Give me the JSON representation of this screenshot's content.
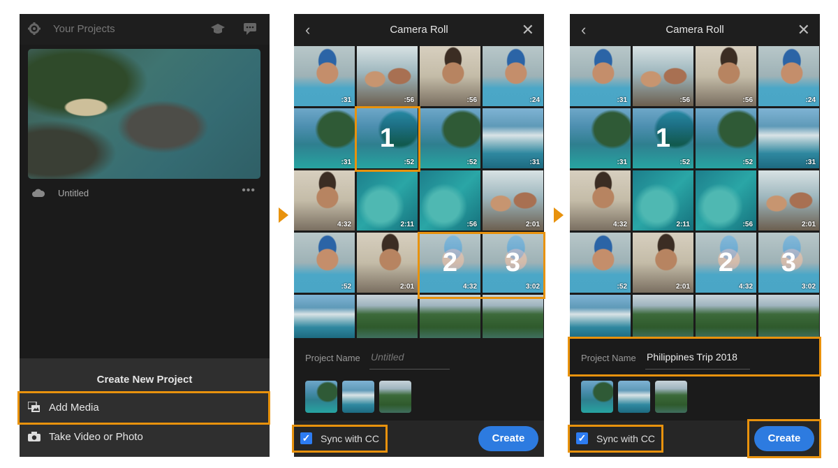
{
  "colors": {
    "accent": "#e8920d",
    "create_button": "#2d7be0",
    "checkbox": "#2d7cf2"
  },
  "panel1": {
    "header_title": "Your Projects",
    "project_name": "Untitled",
    "more_glyph": "•••",
    "sheet": {
      "title": "Create New Project",
      "items": [
        {
          "label": "Add Media",
          "icon": "media-icon"
        },
        {
          "label": "Take Video or Photo",
          "icon": "camera-icon"
        }
      ]
    }
  },
  "panel2": {
    "title": "Camera Roll",
    "durations": [
      ":31",
      ":56",
      ":56",
      ":24",
      ":31",
      ":52",
      ":52",
      ":31",
      "4:32",
      "2:11",
      ":56",
      "2:01",
      ":52",
      "2:01",
      "4:32",
      "3:02"
    ],
    "selection_numbers": [
      "1",
      "2",
      "3"
    ],
    "project_name_label": "Project Name",
    "project_name_placeholder": "Untitled",
    "sync_label": "Sync with CC",
    "create_label": "Create"
  },
  "panel3": {
    "title": "Camera Roll",
    "durations": [
      ":31",
      ":56",
      ":56",
      ":24",
      ":31",
      ":52",
      ":52",
      ":31",
      "4:32",
      "2:11",
      ":56",
      "2:01",
      ":52",
      "2:01",
      "4:32",
      "3:02"
    ],
    "selection_numbers": [
      "1",
      "2",
      "3"
    ],
    "project_name_label": "Project Name",
    "project_name_value": "Philippines Trip 2018",
    "sync_label": "Sync with CC",
    "create_label": "Create"
  }
}
